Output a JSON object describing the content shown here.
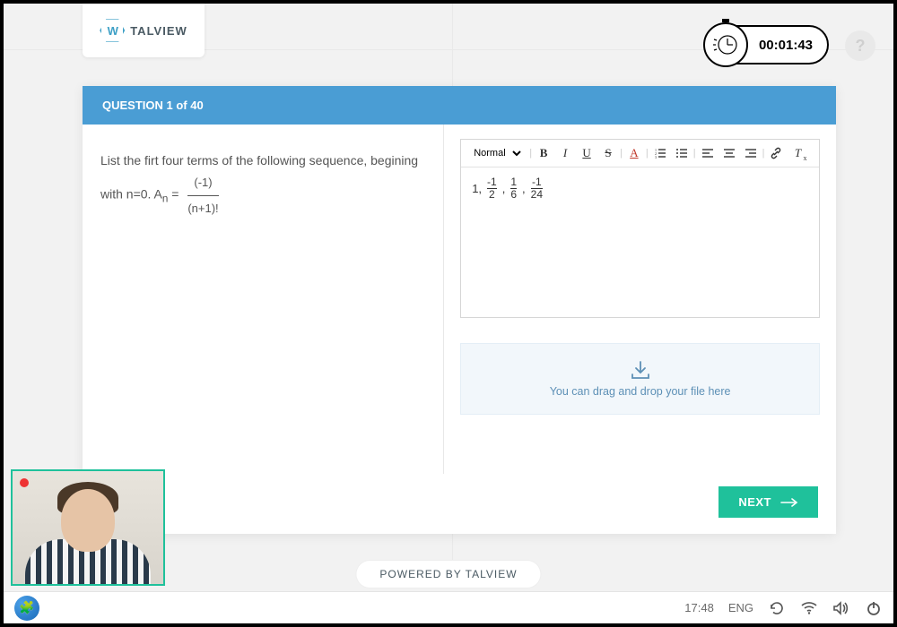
{
  "brand": {
    "name": "TALVIEW",
    "mark": "W"
  },
  "timer": {
    "value": "00:01:43"
  },
  "help": {
    "label": "?"
  },
  "question": {
    "header": "QUESTION 1 of 40",
    "prompt_prefix": "List the firt four terms of the following sequence, begining with n=0. A",
    "prompt_sub": "n",
    "prompt_eq": " = ",
    "frac_top": "(-1)",
    "frac_bot": "(n+1)!"
  },
  "editor": {
    "style_select": "Normal",
    "answer": {
      "lead": "1,",
      "t1_top": "-1",
      "t1_bot": "2",
      "sep1": " , ",
      "t2_top": "1",
      "t2_bot": "6",
      "sep2": " , ",
      "t3_top": "-1",
      "t3_bot": "24"
    }
  },
  "dropzone": {
    "text": "You can drag and drop your file here"
  },
  "actions": {
    "next": "NEXT"
  },
  "footer": {
    "powered": "POWERED BY TALVIEW"
  },
  "taskbar": {
    "time": "17:48",
    "lang": "ENG"
  }
}
